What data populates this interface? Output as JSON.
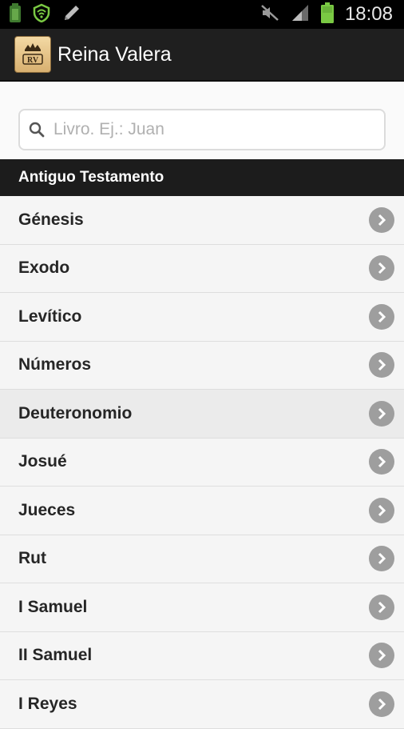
{
  "status_bar": {
    "time": "18:08",
    "icons": [
      "battery-charging-icon",
      "shield-icon",
      "pencil-icon",
      "mute-icon",
      "signal-icon",
      "battery-icon"
    ]
  },
  "app": {
    "title": "Reina Valera",
    "logo_text": "RV"
  },
  "search": {
    "placeholder": "Livro. Ej.: Juan",
    "value": ""
  },
  "section": {
    "title": "Antiguo Testamento"
  },
  "books": [
    {
      "name": "Génesis"
    },
    {
      "name": "Exodo"
    },
    {
      "name": "Levítico"
    },
    {
      "name": "Números"
    },
    {
      "name": "Deuteronomio"
    },
    {
      "name": "Josué"
    },
    {
      "name": "Jueces"
    },
    {
      "name": "Rut"
    },
    {
      "name": "I Samuel"
    },
    {
      "name": "II Samuel"
    },
    {
      "name": "I Reyes"
    }
  ],
  "colors": {
    "status_bar_bg": "#000000",
    "action_bar_bg": "#1f1f1f",
    "section_header_bg": "#1c1c1c",
    "list_bg": "#f5f5f5",
    "chevron_bg": "#9e9e9e",
    "accent_green": "#7ac943"
  }
}
